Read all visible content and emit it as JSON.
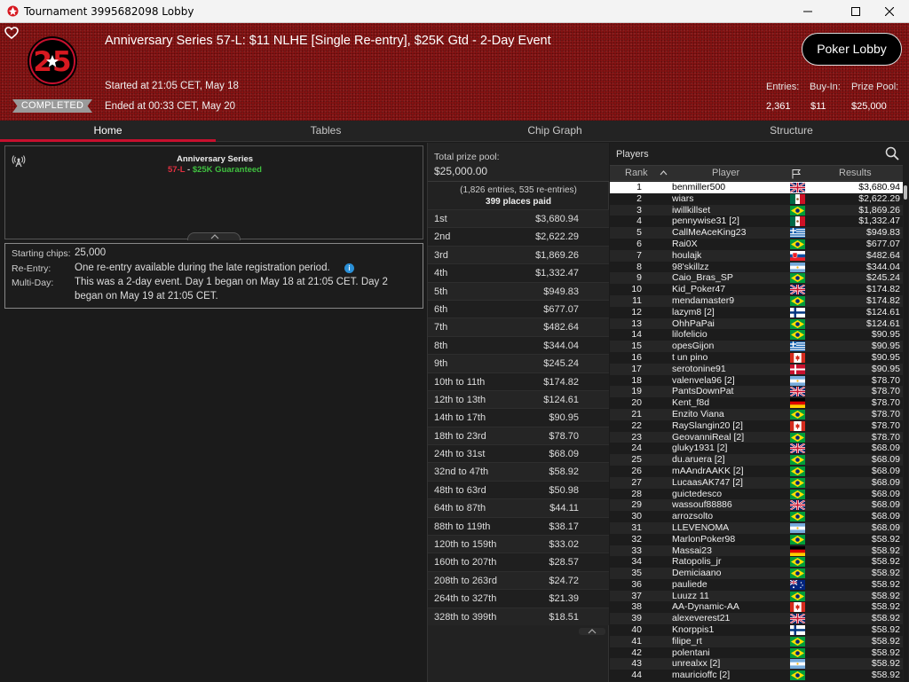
{
  "window": {
    "title": "Tournament 3995682098 Lobby",
    "controls": [
      "minimize-icon",
      "maximize-icon",
      "close-icon"
    ]
  },
  "header": {
    "logo_text": "25",
    "status": "COMPLETED",
    "title": "Anniversary Series 57-L: $11 NLHE [Single Re-entry], $25K Gtd - 2-Day Event",
    "started": "Started at 21:05 CET, May 18",
    "ended": "Ended at 00:33 CET, May 20",
    "lobby_button": "Poker Lobby",
    "stats": {
      "entries_label": "Entries:",
      "entries": "2,361",
      "buyin_label": "Buy-In:",
      "buyin": "$11",
      "prize_label": "Prize Pool:",
      "prize": "$25,000"
    },
    "colors": {
      "header_red": "#8e1414",
      "accent": "#c8102e"
    }
  },
  "tabs": [
    {
      "label": "Home",
      "active": true
    },
    {
      "label": "Tables",
      "active": false
    },
    {
      "label": "Chip Graph",
      "active": false
    },
    {
      "label": "Structure",
      "active": false
    }
  ],
  "series": {
    "name": "Anniversary Series",
    "code": "57-L",
    "separator": " - ",
    "guarantee": "$25K Guaranteed"
  },
  "info": {
    "starting_chips_label": "Starting chips:",
    "starting_chips": "25,000",
    "reentry_label": "Re-Entry:",
    "reentry": "One re-entry available during the late registration period.",
    "multiday_label": "Multi-Day:",
    "multiday_line1": "This was a 2-day event. Day 1 began on May 18 at 21:05 CET. Day 2",
    "multiday_line2": "began on May 19 at 21:05 CET."
  },
  "prize": {
    "label": "Total prize pool:",
    "amount": "$25,000.00",
    "entries_note": "(1,826 entries, 535 re-entries)",
    "places_paid": "399 places paid",
    "rows": [
      {
        "place": "1st",
        "amount": "$3,680.94"
      },
      {
        "place": "2nd",
        "amount": "$2,622.29"
      },
      {
        "place": "3rd",
        "amount": "$1,869.26"
      },
      {
        "place": "4th",
        "amount": "$1,332.47"
      },
      {
        "place": "5th",
        "amount": "$949.83"
      },
      {
        "place": "6th",
        "amount": "$677.07"
      },
      {
        "place": "7th",
        "amount": "$482.64"
      },
      {
        "place": "8th",
        "amount": "$344.04"
      },
      {
        "place": "9th",
        "amount": "$245.24"
      },
      {
        "place": "10th to 11th",
        "amount": "$174.82"
      },
      {
        "place": "12th to 13th",
        "amount": "$124.61"
      },
      {
        "place": "14th to 17th",
        "amount": "$90.95"
      },
      {
        "place": "18th to 23rd",
        "amount": "$78.70"
      },
      {
        "place": "24th to 31st",
        "amount": "$68.09"
      },
      {
        "place": "32nd to 47th",
        "amount": "$58.92"
      },
      {
        "place": "48th to 63rd",
        "amount": "$50.98"
      },
      {
        "place": "64th to 87th",
        "amount": "$44.11"
      },
      {
        "place": "88th to 119th",
        "amount": "$38.17"
      },
      {
        "place": "120th to 159th",
        "amount": "$33.02"
      },
      {
        "place": "160th to 207th",
        "amount": "$28.57"
      },
      {
        "place": "208th to 263rd",
        "amount": "$24.72"
      },
      {
        "place": "264th to 327th",
        "amount": "$21.39"
      },
      {
        "place": "328th to 399th",
        "amount": "$18.51"
      }
    ]
  },
  "players": {
    "title": "Players",
    "columns": {
      "rank": "Rank",
      "player": "Player",
      "results": "Results"
    },
    "rows": [
      {
        "rank": "1",
        "name": "benmiller500",
        "flag": "uk",
        "result": "$3,680.94"
      },
      {
        "rank": "2",
        "name": "wiars",
        "flag": "mx",
        "result": "$2,622.29"
      },
      {
        "rank": "3",
        "name": "iwillkillset",
        "flag": "br",
        "result": "$1,869.26"
      },
      {
        "rank": "4",
        "name": "pennywise31 [2]",
        "flag": "mx",
        "result": "$1,332.47"
      },
      {
        "rank": "5",
        "name": "CallMeAceKing23",
        "flag": "gr",
        "result": "$949.83"
      },
      {
        "rank": "6",
        "name": "Rai0X",
        "flag": "br",
        "result": "$677.07"
      },
      {
        "rank": "7",
        "name": "houlajk",
        "flag": "sk",
        "result": "$482.64"
      },
      {
        "rank": "8",
        "name": "98'skillzz",
        "flag": "ar",
        "result": "$344.04"
      },
      {
        "rank": "9",
        "name": "Caio_Bras_SP",
        "flag": "br",
        "result": "$245.24"
      },
      {
        "rank": "10",
        "name": "Kid_Poker47",
        "flag": "uk",
        "result": "$174.82"
      },
      {
        "rank": "11",
        "name": "mendamaster9",
        "flag": "br",
        "result": "$174.82"
      },
      {
        "rank": "12",
        "name": "lazym8 [2]",
        "flag": "fi",
        "result": "$124.61"
      },
      {
        "rank": "13",
        "name": "OhhPaPai",
        "flag": "br",
        "result": "$124.61"
      },
      {
        "rank": "14",
        "name": "lilofelicio",
        "flag": "br",
        "result": "$90.95"
      },
      {
        "rank": "15",
        "name": "opesGijon",
        "flag": "gr",
        "result": "$90.95"
      },
      {
        "rank": "16",
        "name": "t un pino",
        "flag": "ca",
        "result": "$90.95"
      },
      {
        "rank": "17",
        "name": "serotonine91",
        "flag": "dk",
        "result": "$90.95"
      },
      {
        "rank": "18",
        "name": "valenvela96 [2]",
        "flag": "ar",
        "result": "$78.70"
      },
      {
        "rank": "19",
        "name": "PantsDownPat",
        "flag": "uk",
        "result": "$78.70"
      },
      {
        "rank": "20",
        "name": "Kent_f8d",
        "flag": "de",
        "result": "$78.70"
      },
      {
        "rank": "21",
        "name": "Enzito Viana",
        "flag": "br",
        "result": "$78.70"
      },
      {
        "rank": "22",
        "name": "RaySlangin20 [2]",
        "flag": "ca",
        "result": "$78.70"
      },
      {
        "rank": "23",
        "name": "GeovanniReal [2]",
        "flag": "br",
        "result": "$78.70"
      },
      {
        "rank": "24",
        "name": "gluky1931 [2]",
        "flag": "uk",
        "result": "$68.09"
      },
      {
        "rank": "25",
        "name": "du.aruera [2]",
        "flag": "br",
        "result": "$68.09"
      },
      {
        "rank": "26",
        "name": "mAAndrAAKK [2]",
        "flag": "br",
        "result": "$68.09"
      },
      {
        "rank": "27",
        "name": "LucaasAK747 [2]",
        "flag": "br",
        "result": "$68.09"
      },
      {
        "rank": "28",
        "name": "guictedesco",
        "flag": "br",
        "result": "$68.09"
      },
      {
        "rank": "29",
        "name": "wassouf88886",
        "flag": "uk",
        "result": "$68.09"
      },
      {
        "rank": "30",
        "name": "arrozsolto",
        "flag": "br",
        "result": "$68.09"
      },
      {
        "rank": "31",
        "name": "LLEVENOMA",
        "flag": "ar",
        "result": "$68.09"
      },
      {
        "rank": "32",
        "name": "MarlonPoker98",
        "flag": "br",
        "result": "$58.92"
      },
      {
        "rank": "33",
        "name": "Massai23",
        "flag": "de",
        "result": "$58.92"
      },
      {
        "rank": "34",
        "name": "Ratopolis_jr",
        "flag": "br",
        "result": "$58.92"
      },
      {
        "rank": "35",
        "name": "Demiciaano",
        "flag": "br",
        "result": "$58.92"
      },
      {
        "rank": "36",
        "name": "pauliede",
        "flag": "au",
        "result": "$58.92"
      },
      {
        "rank": "37",
        "name": "Luuzz 11",
        "flag": "br",
        "result": "$58.92"
      },
      {
        "rank": "38",
        "name": "AA-Dynamic-AA",
        "flag": "ca",
        "result": "$58.92"
      },
      {
        "rank": "39",
        "name": "alexeverest21",
        "flag": "uk",
        "result": "$58.92"
      },
      {
        "rank": "40",
        "name": "Knorppis1",
        "flag": "fi",
        "result": "$58.92"
      },
      {
        "rank": "41",
        "name": "filipe_rt",
        "flag": "br",
        "result": "$58.92"
      },
      {
        "rank": "42",
        "name": "polentani",
        "flag": "br",
        "result": "$58.92"
      },
      {
        "rank": "43",
        "name": "unrealxx [2]",
        "flag": "ar",
        "result": "$58.92"
      },
      {
        "rank": "44",
        "name": "mauricioffc [2]",
        "flag": "br",
        "result": "$58.92"
      }
    ]
  }
}
